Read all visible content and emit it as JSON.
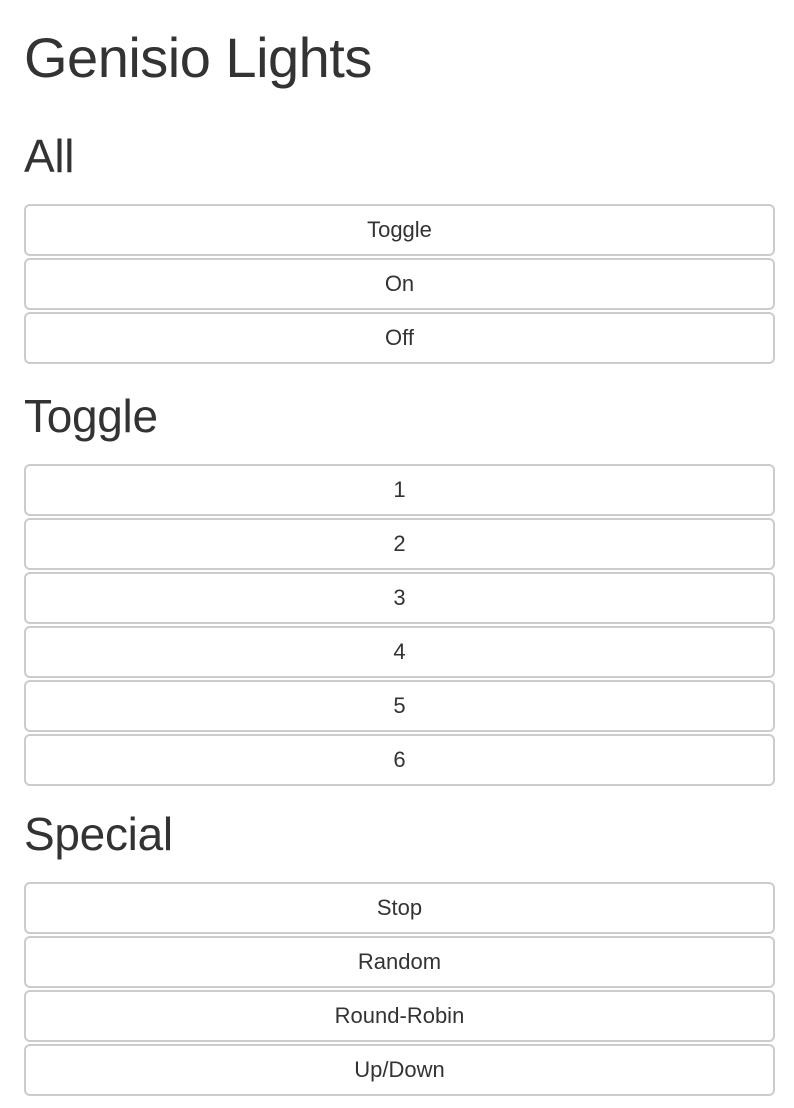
{
  "page": {
    "title": "Genisio Lights"
  },
  "sections": [
    {
      "title": "All",
      "buttons": [
        "Toggle",
        "On",
        "Off"
      ]
    },
    {
      "title": "Toggle",
      "buttons": [
        "1",
        "2",
        "3",
        "4",
        "5",
        "6"
      ]
    },
    {
      "title": "Special",
      "buttons": [
        "Stop",
        "Random",
        "Round-Robin",
        "Up/Down"
      ]
    }
  ]
}
